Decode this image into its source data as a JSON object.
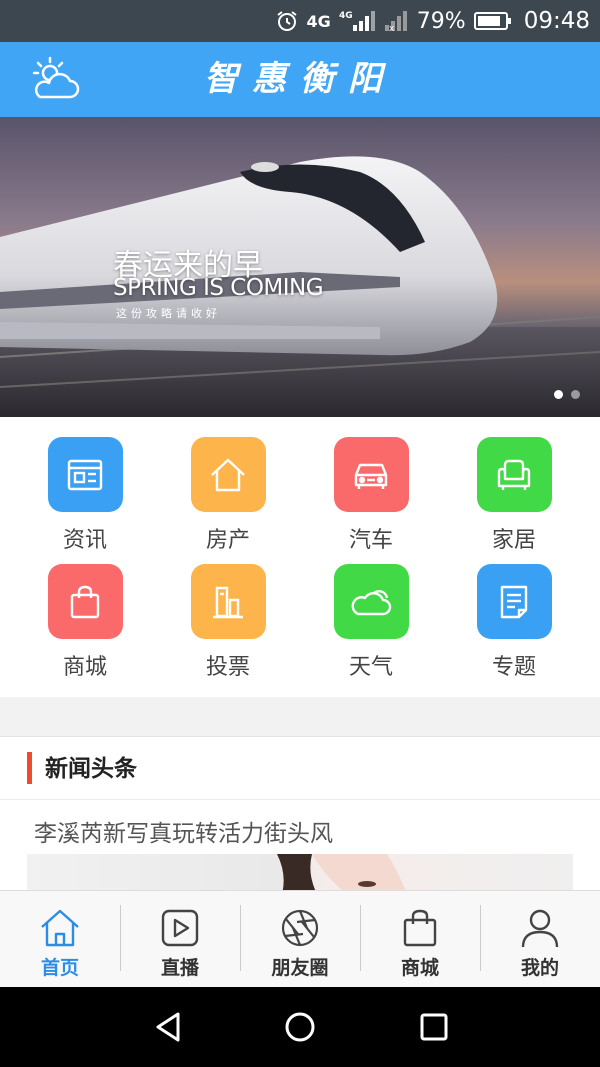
{
  "status_bar": {
    "network_1": "4G",
    "network_2": "4G",
    "battery": "79%",
    "time": "09:48"
  },
  "header": {
    "title": "智惠衡阳",
    "weather_icon": "weather-cloud-sun-icon"
  },
  "banner": {
    "title": "春运来的早",
    "subtitle": "SPRING IS COMING",
    "small_text": "这份攻略请收好",
    "active_slide": 1,
    "slide_count": 2
  },
  "grid": {
    "items": [
      {
        "label": "资讯",
        "icon": "news-icon",
        "color": "#3aa0f3"
      },
      {
        "label": "房产",
        "icon": "house-icon",
        "color": "#fdb54b"
      },
      {
        "label": "汽车",
        "icon": "car-icon",
        "color": "#fb6a6a"
      },
      {
        "label": "家居",
        "icon": "sofa-icon",
        "color": "#41d945"
      },
      {
        "label": "商城",
        "icon": "shopping-bag-icon",
        "color": "#fb6a6a"
      },
      {
        "label": "投票",
        "icon": "bar-chart-icon",
        "color": "#fdb54b"
      },
      {
        "label": "天气",
        "icon": "cloud-icon",
        "color": "#41d945"
      },
      {
        "label": "专题",
        "icon": "document-icon",
        "color": "#3aa0f3"
      }
    ]
  },
  "news": {
    "section_title": "新闻头条",
    "items": [
      {
        "title": "李溪芮新写真玩转活力街头风"
      }
    ]
  },
  "tabbar": {
    "items": [
      {
        "label": "首页",
        "icon": "home-icon",
        "active": true
      },
      {
        "label": "直播",
        "icon": "play-icon",
        "active": false
      },
      {
        "label": "朋友圈",
        "icon": "aperture-icon",
        "active": false
      },
      {
        "label": "商城",
        "icon": "shopping-bag-icon",
        "active": false
      },
      {
        "label": "我的",
        "icon": "user-icon",
        "active": false
      }
    ],
    "active_color": "#2d8de6"
  },
  "colors": {
    "header": "#41a5f5",
    "accent_bar": "#f04a2e"
  }
}
